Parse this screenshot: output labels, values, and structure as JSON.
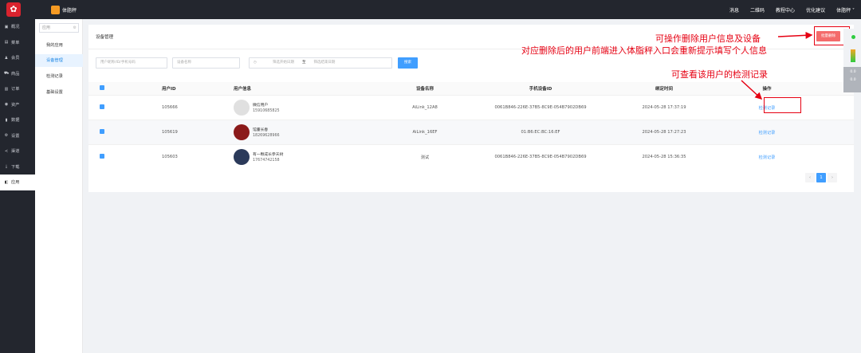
{
  "topbar": {
    "brand": "体脂秤",
    "nav": [
      "消息",
      "二维码",
      "教程中心",
      "优化建议",
      "体脂秤 ˅"
    ]
  },
  "sidebar": {
    "items": [
      {
        "icon": "▣",
        "label": "概况"
      },
      {
        "icon": "▤",
        "label": "菜单"
      },
      {
        "icon": "♟",
        "label": "会员"
      },
      {
        "icon": "⛟",
        "label": "商品"
      },
      {
        "icon": "▥",
        "label": "订单"
      },
      {
        "icon": "◉",
        "label": "资产"
      },
      {
        "icon": "▮",
        "label": "数据"
      },
      {
        "icon": "⚙",
        "label": "设置"
      },
      {
        "icon": "≺",
        "label": "渠道"
      },
      {
        "icon": "⤓",
        "label": "下载"
      },
      {
        "icon": "◧",
        "label": "应用"
      }
    ]
  },
  "subsidebar": {
    "app_input": "应用",
    "items": [
      "我的应用",
      "设备管理",
      "检测记录",
      "基础设置"
    ]
  },
  "main": {
    "breadcrumb": "设备管理",
    "batch_delete": "批量删除",
    "filters": {
      "user": "用户昵称/ID/手机号码",
      "device": "设备名称",
      "start": "筛选开始日期",
      "sep": "至",
      "end": "筛选结束日期",
      "search": "搜索"
    },
    "columns": [
      "用户ID",
      "用户信息",
      "设备名称",
      "手机设备ID",
      "绑定时间",
      "操作"
    ],
    "rows": [
      {
        "id": "105666",
        "name": "微信用户",
        "phone": "15910685825",
        "device": "AiLink_12A8",
        "mobile_id": "0061B846-226E-37B5-8C9E-054B7902DB69",
        "time": "2024-05-28 17:37:19",
        "op": "检测记录"
      },
      {
        "id": "105619",
        "name": "馆董长春",
        "phone": "18269628966",
        "device": "AiLink_16EF",
        "mobile_id": "01:B6:EC:BC:16:EF",
        "time": "2024-05-28 17:27:23",
        "op": "检测记录"
      },
      {
        "id": "105603",
        "name": "有一颗成长参天树",
        "phone": "17674742158",
        "device": "测试",
        "mobile_id": "0061B846-226E-37B5-8C9E-054B7902DB69",
        "time": "2024-05-28 15:36:35",
        "op": "检测记录"
      }
    ],
    "pager": {
      "prev": "‹",
      "current": "1",
      "next": "›"
    }
  },
  "annotations": {
    "a1": "可操作删除用户信息及设备",
    "a2": "对应删除后的用户前端进入体脂秤入口会重新提示填写个人信息",
    "a3": "可查看该用户的检测记录"
  },
  "rightstrip": [
    "0.0",
    "0.0"
  ],
  "colors": {
    "accent": "#409eff",
    "danger": "#f46b6b",
    "annotation": "#e60012",
    "dark": "#23262e"
  }
}
